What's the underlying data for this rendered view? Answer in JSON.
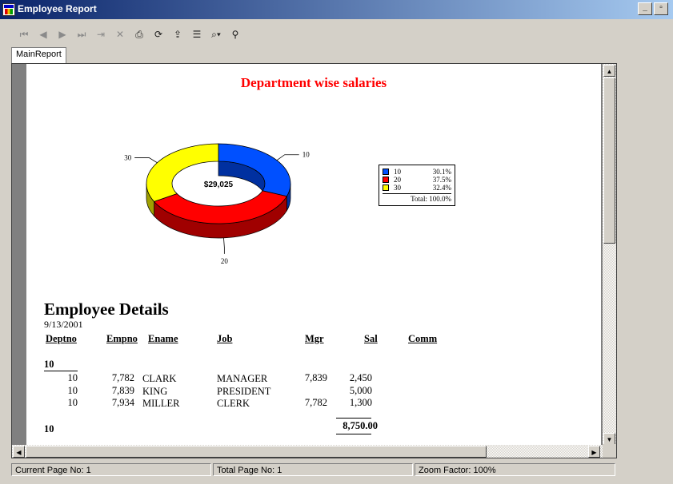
{
  "window": {
    "title": "Employee Report"
  },
  "toolbar": {
    "icons": [
      "first-page-icon",
      "prev-page-icon",
      "next-page-icon",
      "last-page-icon",
      "goto-page-icon",
      "stop-icon",
      "print-icon",
      "refresh-icon",
      "export-icon",
      "group-tree-icon",
      "zoom-icon",
      "search-icon"
    ]
  },
  "tabs": [
    {
      "label": "MainReport"
    }
  ],
  "report": {
    "title": "Department wise salaries",
    "colors": {
      "title": "#ff0000",
      "dept10": "#0050ff",
      "dept20": "#ff0000",
      "dept30": "#ffff00"
    },
    "chart_data": {
      "type": "pie",
      "variant": "doughnut-3d",
      "center_label": "$29,025",
      "categories": [
        "10",
        "20",
        "30"
      ],
      "values": [
        30.1,
        37.5,
        32.4
      ],
      "value_labels": [
        "30.1%",
        "37.5%",
        "32.4%"
      ],
      "total_label": "Total:",
      "total_value": "100.0%",
      "legend": "right"
    },
    "section_title": "Employee Details",
    "date": "9/13/2001",
    "columns": [
      "Deptno",
      "Empno",
      "Ename",
      "Job",
      "Mgr",
      "Sal",
      "Comm"
    ],
    "group_label": "10",
    "rows": [
      {
        "deptno": "10",
        "empno": "7,782",
        "ename": "CLARK",
        "job": "MANAGER",
        "mgr": "7,839",
        "sal": "2,450"
      },
      {
        "deptno": "10",
        "empno": "7,839",
        "ename": "KING",
        "job": "PRESIDENT",
        "mgr": "",
        "sal": "5,000"
      },
      {
        "deptno": "10",
        "empno": "7,934",
        "ename": "MILLER",
        "job": "CLERK",
        "mgr": "7,782",
        "sal": "1,300"
      }
    ],
    "group_footer_label": "10",
    "group_total": "8,750.00"
  },
  "status": {
    "current_page": "Current Page No: 1",
    "total_page": "Total Page No: 1",
    "zoom": "Zoom Factor: 100%"
  }
}
